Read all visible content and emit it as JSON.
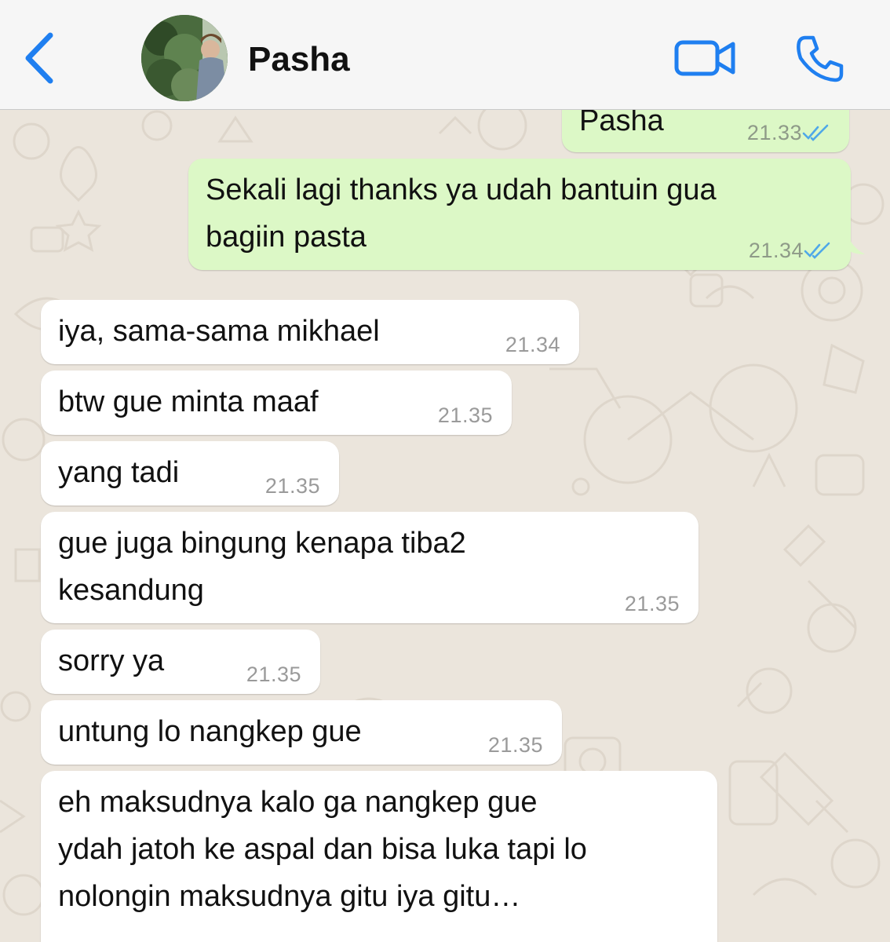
{
  "header": {
    "contact_name": "Pasha",
    "back_icon": "chevron-left-icon",
    "video_icon": "video-camera-icon",
    "call_icon": "phone-icon",
    "accent_color": "#1f7ff0"
  },
  "messages": [
    {
      "direction": "out",
      "text": "Pasha",
      "time": "21.33",
      "status": "read"
    },
    {
      "direction": "out",
      "text": "Sekali lagi thanks ya udah bantuin gua\nbagiin pasta",
      "time": "21.34",
      "status": "read"
    },
    {
      "direction": "in",
      "text": "iya, sama-sama mikhael",
      "time": "21.34"
    },
    {
      "direction": "in",
      "text": "btw gue minta maaf",
      "time": "21.35"
    },
    {
      "direction": "in",
      "text": "yang tadi",
      "time": "21.35"
    },
    {
      "direction": "in",
      "text": "gue juga bingung kenapa tiba2\nkesandung",
      "time": "21.35"
    },
    {
      "direction": "in",
      "text": "sorry ya",
      "time": "21.35"
    },
    {
      "direction": "in",
      "text": "untung lo nangkep gue",
      "time": "21.35"
    },
    {
      "direction": "in",
      "text": "eh maksudnya kalo ga nangkep gue\nydah jatoh ke aspal dan bisa luka tapi lo\nnolongin maksudnya gitu iya gitu…",
      "time": ""
    }
  ],
  "colors": {
    "outgoing_bubble": "#dcf8c6",
    "incoming_bubble": "#ffffff",
    "read_ticks": "#4fa8e8",
    "chat_background": "#ebe5dc"
  }
}
